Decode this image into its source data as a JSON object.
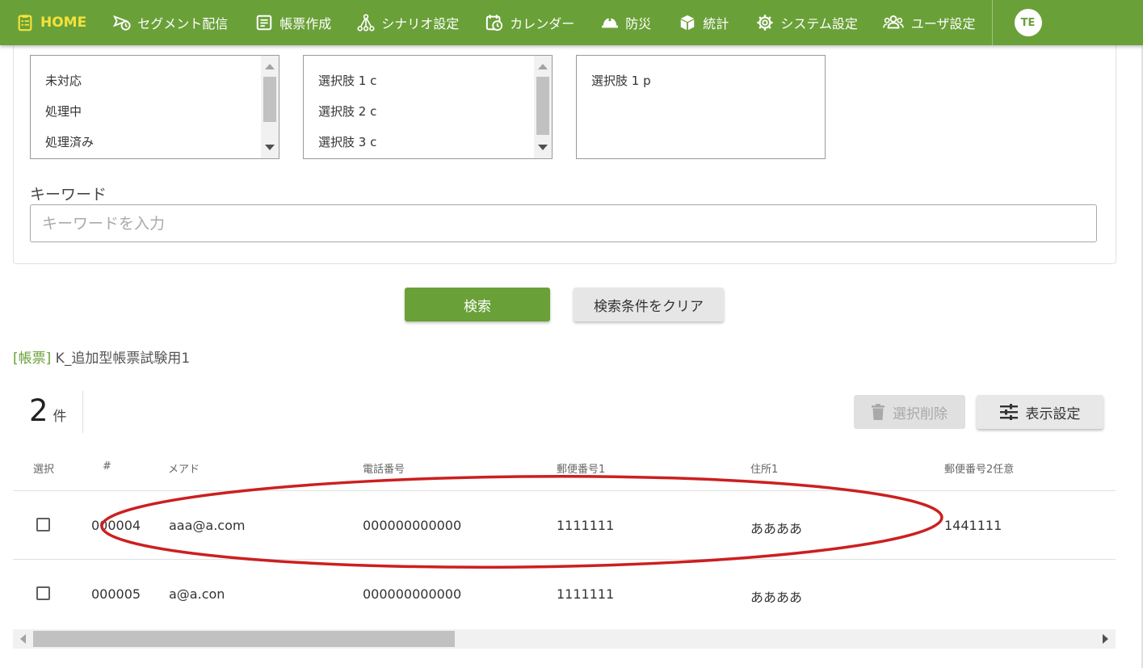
{
  "nav": {
    "items": [
      {
        "label": "HOME",
        "icon": "clipboard-icon"
      },
      {
        "label": "セグメント配信",
        "icon": "send-clock-icon"
      },
      {
        "label": "帳票作成",
        "icon": "document-icon"
      },
      {
        "label": "シナリオ設定",
        "icon": "scenario-tree-icon"
      },
      {
        "label": "カレンダー",
        "icon": "calendar-clock-icon"
      },
      {
        "label": "防災",
        "icon": "helmet-icon"
      },
      {
        "label": "統計",
        "icon": "box-icon"
      },
      {
        "label": "システム設定",
        "icon": "gear-icon"
      },
      {
        "label": "ユーザ設定",
        "icon": "users-icon"
      }
    ],
    "avatar": "TE",
    "colors": {
      "bar": "#6aa038",
      "active": "#f3e23a"
    }
  },
  "filters": {
    "status_options": [
      "未対応",
      "処理中",
      "処理済み"
    ],
    "choice_c_options": [
      "選択肢 1 c",
      "選択肢 2 c",
      "選択肢 3 c"
    ],
    "choice_p_options": [
      "選択肢 1 p"
    ]
  },
  "keyword": {
    "label": "キーワード",
    "placeholder": "キーワードを入力",
    "value": ""
  },
  "buttons": {
    "search": "検索",
    "clear": "検索条件をクリア",
    "delete_selected": "選択削除",
    "display_settings": "表示設定"
  },
  "form": {
    "tag": "[帳票]",
    "name": "K_追加型帳票試験用1"
  },
  "result": {
    "count": "2",
    "unit": "件"
  },
  "table": {
    "headers": [
      "選択",
      "#",
      "メアド",
      "電話番号",
      "郵便番号1",
      "住所1",
      "郵便番号2任意"
    ],
    "rows": [
      {
        "id": "000004",
        "email": "aaa@a.com",
        "phone": "000000000000",
        "zip1": "1111111",
        "address1": "ああああ",
        "zip2": "1441111"
      },
      {
        "id": "000005",
        "email": "a@a.con",
        "phone": "000000000000",
        "zip1": "1111111",
        "address1": "ああああ",
        "zip2": ""
      }
    ]
  },
  "annotation": {
    "color": "#cc1f1f"
  }
}
